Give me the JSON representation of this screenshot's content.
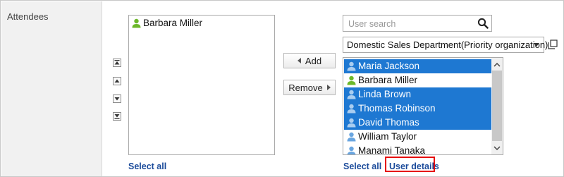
{
  "field": {
    "label": "Attendees"
  },
  "selected_list": {
    "items": [
      {
        "name": "Barbara Miller",
        "icon": "user-green-icon",
        "selected": false
      }
    ],
    "select_all_label": "Select all"
  },
  "order_buttons": [
    "move-top-icon",
    "move-up-icon",
    "move-down-icon",
    "move-bottom-icon"
  ],
  "actions": {
    "add_label": "Add",
    "remove_label": "Remove"
  },
  "search": {
    "placeholder": "User search",
    "value": ""
  },
  "group_select": {
    "value": "Domestic Sales Department(Priority organization)"
  },
  "candidate_list": {
    "items": [
      {
        "name": "Maria Jackson",
        "icon": "user-blue-icon",
        "selected": true
      },
      {
        "name": "Barbara Miller",
        "icon": "user-green-icon",
        "selected": false
      },
      {
        "name": "Linda Brown",
        "icon": "user-blue-icon",
        "selected": true
      },
      {
        "name": "Thomas Robinson",
        "icon": "user-blue-icon",
        "selected": true
      },
      {
        "name": "David Thomas",
        "icon": "user-blue-icon",
        "selected": true
      },
      {
        "name": "William Taylor",
        "icon": "user-blue-icon",
        "selected": false
      },
      {
        "name": "Manami Tanaka",
        "icon": "user-blue-icon",
        "selected": false
      }
    ],
    "select_all_label": "Select all",
    "user_details_label": "User details"
  },
  "colors": {
    "selection": "#1e78d2",
    "link": "#1a4a9a",
    "highlight": "#e60000",
    "user_blue": "#6aa6e0",
    "user_green": "#6cb82a"
  }
}
